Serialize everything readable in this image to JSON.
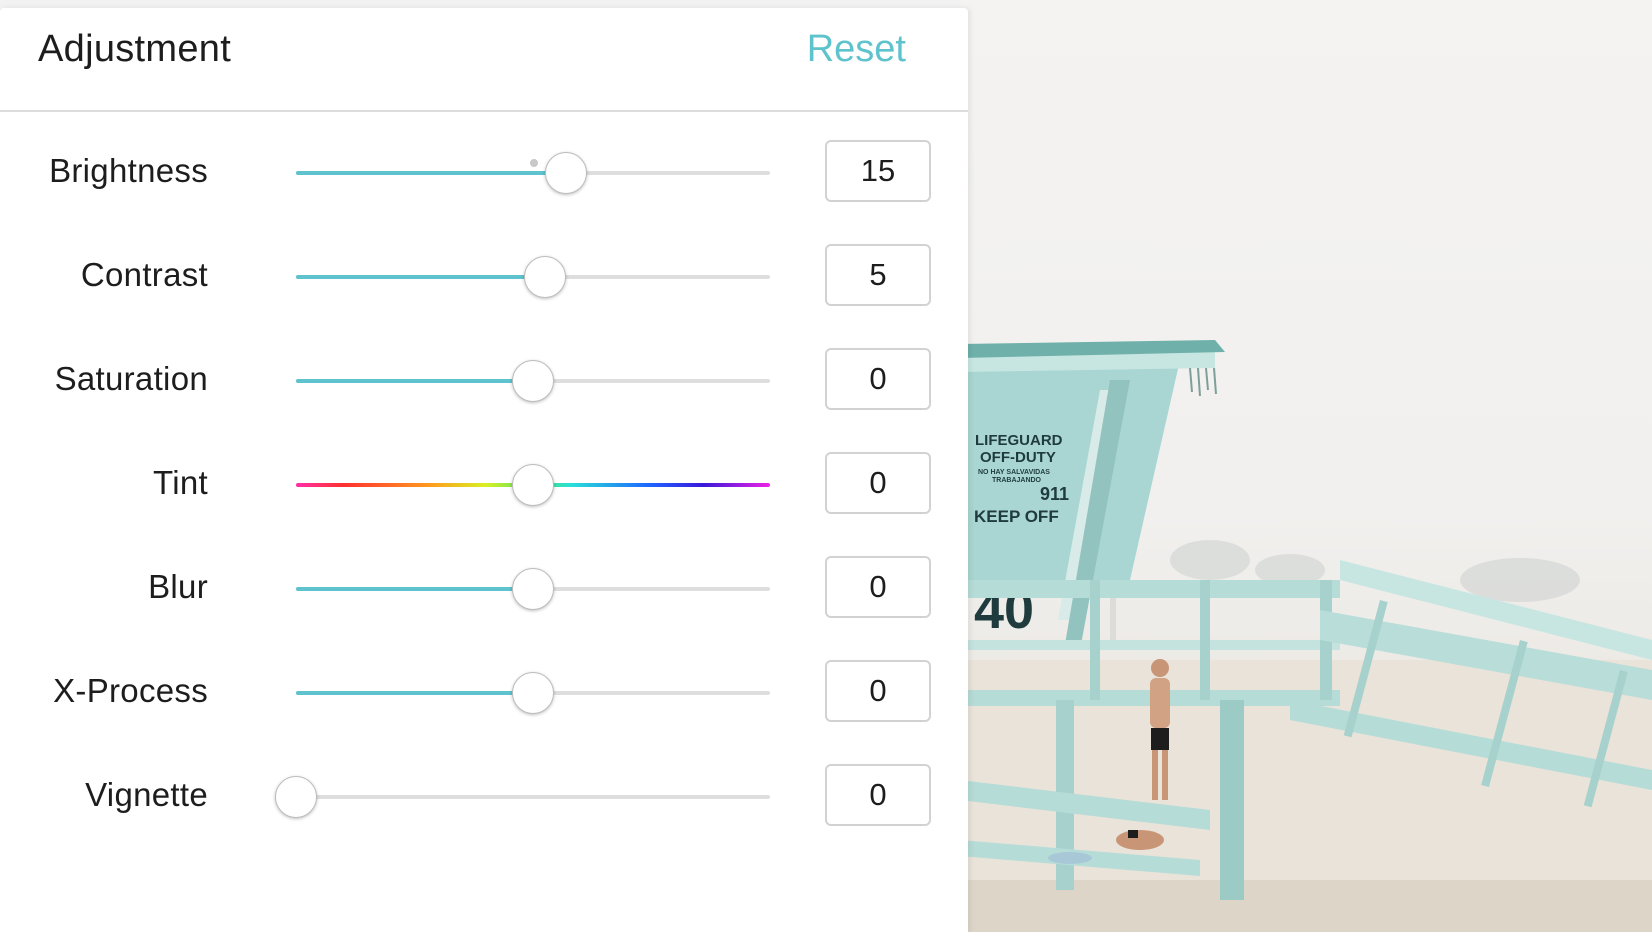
{
  "panel": {
    "title": "Adjustment",
    "reset_label": "Reset"
  },
  "adjustments": [
    {
      "label": "Brightness",
      "value": "15",
      "level": 0.57,
      "track": "fill"
    },
    {
      "label": "Contrast",
      "value": "5",
      "level": 0.525,
      "track": "fill"
    },
    {
      "label": "Saturation",
      "value": "0",
      "level": 0.5,
      "track": "fill"
    },
    {
      "label": "Tint",
      "value": "0",
      "level": 0.5,
      "track": "rainbow"
    },
    {
      "label": "Blur",
      "value": "0",
      "level": 0.5,
      "track": "fill"
    },
    {
      "label": "X-Process",
      "value": "0",
      "level": 0.5,
      "track": "fill"
    },
    {
      "label": "Vignette",
      "value": "0",
      "level": 0.0,
      "track": "fill"
    }
  ],
  "photo": {
    "tower_sign_lines": [
      "LIFEGUARD",
      "OFF-DUTY",
      "NO HAY SALVAVIDAS",
      "TRABAJANDO",
      "911",
      "KEEP OFF"
    ],
    "tower_number": "40"
  },
  "colors": {
    "accent": "#5ec3cc",
    "track": "#dedede",
    "text": "#1d1d1d"
  }
}
